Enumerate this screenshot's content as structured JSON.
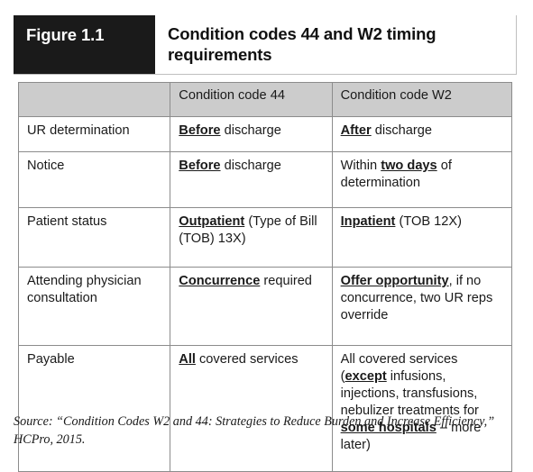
{
  "figure": {
    "label": "Figure 1.1",
    "title": "Condition codes 44 and W2 timing requirements"
  },
  "colors": {
    "banner_bg": "#1a1a1a",
    "banner_text": "#ffffff",
    "header_row_bg": "#cccccc",
    "table_border": "#8c8c8c",
    "body_text": "#1a1a1a",
    "page_bg": "#ffffff"
  },
  "table": {
    "headers": [
      "",
      "Condition code 44",
      "Condition code W2"
    ],
    "rows": [
      {
        "label": "UR determination",
        "cc44": {
          "emphasis": "Before",
          "rest": " discharge"
        },
        "ccw2": {
          "emphasis": "After",
          "rest": " discharge"
        }
      },
      {
        "label": "Notice",
        "cc44": {
          "emphasis": "Before",
          "rest": " discharge"
        },
        "ccw2": {
          "pre": "Within ",
          "emphasis": "two days",
          "rest": " of determination"
        }
      },
      {
        "label": "Patient status",
        "cc44": {
          "emphasis": "Outpatient",
          "rest": " (Type of Bill (TOB) 13X)"
        },
        "ccw2": {
          "emphasis": "Inpatient",
          "rest": " (TOB 12X)"
        }
      },
      {
        "label": "Attending physician consultation",
        "cc44": {
          "emphasis": "Concurrence",
          "rest": " required"
        },
        "ccw2": {
          "emphasis": "Offer opportunity",
          "rest": ", if no concurrence, two UR reps override"
        }
      },
      {
        "label": "Payable",
        "cc44": {
          "emphasis": "All",
          "rest": " covered services"
        },
        "ccw2": {
          "pre": "All covered services (",
          "emphasis": "except",
          "mid": " infusions, injections, transfusions, nebulizer treatments for ",
          "emphasis2": "some hospitals",
          "rest": " – more later)"
        }
      }
    ]
  },
  "source": {
    "text": "Source: “Condition Codes W2 and 44: Strategies to Reduce Burden and Increase Efficiency,” HCPro, 2015."
  }
}
